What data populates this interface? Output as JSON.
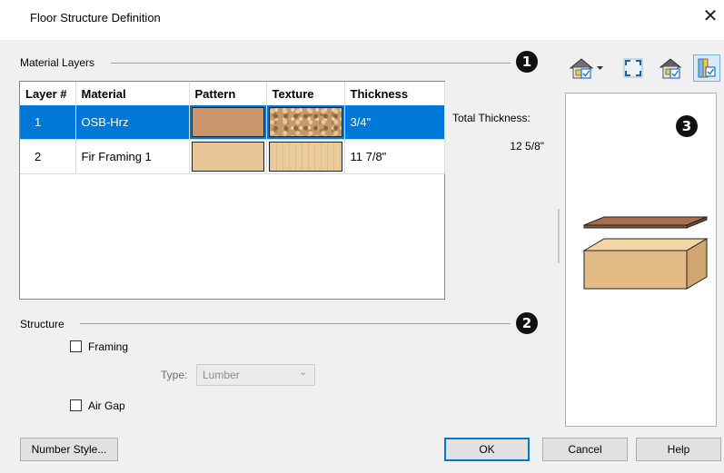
{
  "window": {
    "title": "Floor Structure Definition",
    "close_label": "✕"
  },
  "material_layers": {
    "label": "Material Layers",
    "callout": "1",
    "columns": [
      "Layer #",
      "Material",
      "Pattern",
      "Texture",
      "Thickness"
    ],
    "rows": [
      {
        "layer": "1",
        "material": "OSB-Hrz",
        "pattern": "osb-pattern",
        "texture": "osb-texture",
        "thickness": "3/4\"",
        "selected": true
      },
      {
        "layer": "2",
        "material": "Fir Framing 1",
        "pattern": "fir-pattern",
        "texture": "fir-texture",
        "thickness": "11 7/8\"",
        "selected": false
      }
    ],
    "total_label": "Total Thickness:",
    "total_value": "12 5/8\""
  },
  "structure": {
    "label": "Structure",
    "callout": "2",
    "framing_label": "Framing",
    "framing_checked": false,
    "type_label": "Type:",
    "type_value": "Lumber",
    "air_gap_label": "Air Gap",
    "air_gap_checked": false
  },
  "preview": {
    "callout": "3"
  },
  "toolbar": {
    "icons": [
      "view-house-dropdown-icon",
      "fill-window-icon",
      "material-house-icon",
      "layer-view-icon"
    ]
  },
  "buttons": {
    "number_style": "Number Style...",
    "ok": "OK",
    "cancel": "Cancel",
    "help": "Help"
  },
  "colors": {
    "selection": "#0078d7",
    "osb": "#c8956d",
    "fir": "#e8c596"
  }
}
